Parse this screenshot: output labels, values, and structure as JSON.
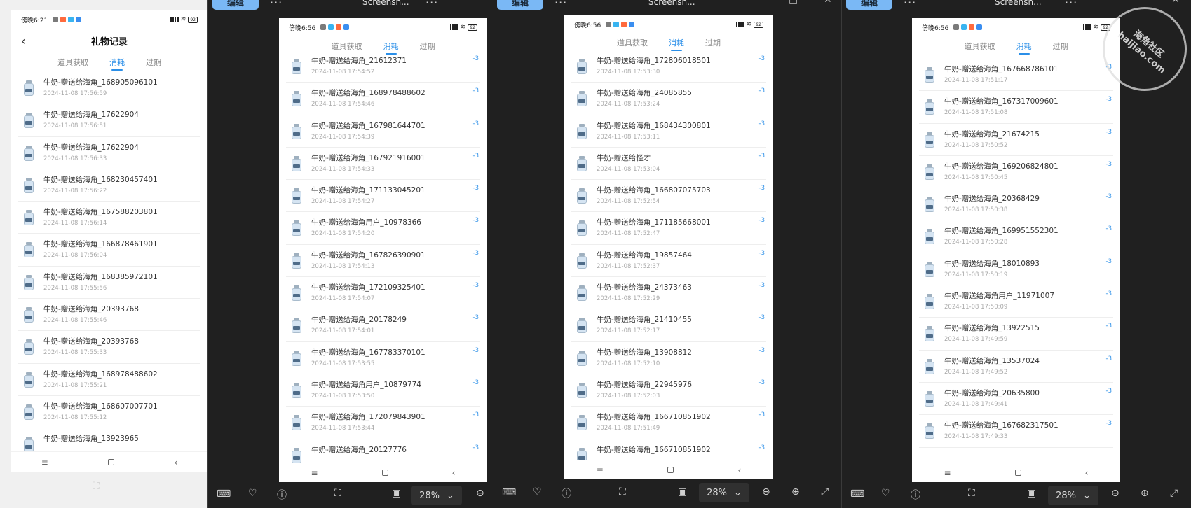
{
  "common": {
    "status_time_a": "傍晚6:21",
    "status_time_b": "傍晚6:56",
    "battery": "92",
    "tab_labels": [
      "道具获取",
      "消耗",
      "过期"
    ],
    "amount": "-3",
    "zoom": "28%",
    "edit_label": "编辑",
    "window_title": "Screensh..."
  },
  "panel1": {
    "page_title": "礼物记录",
    "rows": [
      {
        "name": "牛奶-赠送给海角_168905096101",
        "time": "2024-11-08 17:56:59"
      },
      {
        "name": "牛奶-赠送给海角_17622904",
        "time": "2024-11-08 17:56:51"
      },
      {
        "name": "牛奶-赠送给海角_17622904",
        "time": "2024-11-08 17:56:33"
      },
      {
        "name": "牛奶-赠送给海角_168230457401",
        "time": "2024-11-08 17:56:22"
      },
      {
        "name": "牛奶-赠送给海角_167588203801",
        "time": "2024-11-08 17:56:14"
      },
      {
        "name": "牛奶-赠送给海角_166878461901",
        "time": "2024-11-08 17:56:04"
      },
      {
        "name": "牛奶-赠送给海角_168385972101",
        "time": "2024-11-08 17:55:56"
      },
      {
        "name": "牛奶-赠送给海角_20393768",
        "time": "2024-11-08 17:55:46"
      },
      {
        "name": "牛奶-赠送给海角_20393768",
        "time": "2024-11-08 17:55:33"
      },
      {
        "name": "牛奶-赠送给海角_168978488602",
        "time": "2024-11-08 17:55:21"
      },
      {
        "name": "牛奶-赠送给海角_168607007701",
        "time": "2024-11-08 17:55:12"
      },
      {
        "name": "牛奶-赠送给海角_13923965",
        "time": ""
      }
    ]
  },
  "panel2": {
    "rows": [
      {
        "name": "牛奶-赠送给海角_21612371",
        "time": "2024-11-08 17:54:52"
      },
      {
        "name": "牛奶-赠送给海角_168978488602",
        "time": "2024-11-08 17:54:46"
      },
      {
        "name": "牛奶-赠送给海角_167981644701",
        "time": "2024-11-08 17:54:39"
      },
      {
        "name": "牛奶-赠送给海角_167921916001",
        "time": "2024-11-08 17:54:33"
      },
      {
        "name": "牛奶-赠送给海角_171133045201",
        "time": "2024-11-08 17:54:27"
      },
      {
        "name": "牛奶-赠送给海角用户_10978366",
        "time": "2024-11-08 17:54:20"
      },
      {
        "name": "牛奶-赠送给海角_167826390901",
        "time": "2024-11-08 17:54:13"
      },
      {
        "name": "牛奶-赠送给海角_172109325401",
        "time": "2024-11-08 17:54:07"
      },
      {
        "name": "牛奶-赠送给海角_20178249",
        "time": "2024-11-08 17:54:01"
      },
      {
        "name": "牛奶-赠送给海角_167783370101",
        "time": "2024-11-08 17:53:55"
      },
      {
        "name": "牛奶-赠送给海角用户_10879774",
        "time": "2024-11-08 17:53:50"
      },
      {
        "name": "牛奶-赠送给海角_172079843901",
        "time": "2024-11-08 17:53:44"
      },
      {
        "name": "牛奶-赠送给海角_20127776",
        "time": ""
      }
    ]
  },
  "panel3": {
    "rows": [
      {
        "name": "牛奶-赠送给海角_172806018501",
        "time": "2024-11-08 17:53:30"
      },
      {
        "name": "牛奶-赠送给海角_24085855",
        "time": "2024-11-08 17:53:24"
      },
      {
        "name": "牛奶-赠送给海角_168434300801",
        "time": "2024-11-08 17:53:11"
      },
      {
        "name": "牛奶-赠送给怪才",
        "time": "2024-11-08 17:53:04"
      },
      {
        "name": "牛奶-赠送给海角_166807075703",
        "time": "2024-11-08 17:52:54"
      },
      {
        "name": "牛奶-赠送给海角_171185668001",
        "time": "2024-11-08 17:52:47"
      },
      {
        "name": "牛奶-赠送给海角_19857464",
        "time": "2024-11-08 17:52:37"
      },
      {
        "name": "牛奶-赠送给海角_24373463",
        "time": "2024-11-08 17:52:29"
      },
      {
        "name": "牛奶-赠送给海角_21410455",
        "time": "2024-11-08 17:52:17"
      },
      {
        "name": "牛奶-赠送给海角_13908812",
        "time": "2024-11-08 17:52:10"
      },
      {
        "name": "牛奶-赠送给海角_22945976",
        "time": "2024-11-08 17:52:03"
      },
      {
        "name": "牛奶-赠送给海角_166710851902",
        "time": "2024-11-08 17:51:49"
      },
      {
        "name": "牛奶-赠送给海角_166710851902",
        "time": ""
      }
    ]
  },
  "panel4": {
    "rows": [
      {
        "name": "牛奶-赠送给海角_167668786101",
        "time": "2024-11-08 17:51:17"
      },
      {
        "name": "牛奶-赠送给海角_167317009601",
        "time": "2024-11-08 17:51:08"
      },
      {
        "name": "牛奶-赠送给海角_21674215",
        "time": "2024-11-08 17:50:52"
      },
      {
        "name": "牛奶-赠送给海角_169206824801",
        "time": "2024-11-08 17:50:45"
      },
      {
        "name": "牛奶-赠送给海角_20368429",
        "time": "2024-11-08 17:50:38"
      },
      {
        "name": "牛奶-赠送给海角_169951552301",
        "time": "2024-11-08 17:50:28"
      },
      {
        "name": "牛奶-赠送给海角_18010893",
        "time": "2024-11-08 17:50:19"
      },
      {
        "name": "牛奶-赠送给海角用户_11971007",
        "time": "2024-11-08 17:50:09"
      },
      {
        "name": "牛奶-赠送给海角_13922515",
        "time": "2024-11-08 17:49:59"
      },
      {
        "name": "牛奶-赠送给海角_13537024",
        "time": "2024-11-08 17:49:52"
      },
      {
        "name": "牛奶-赠送给海角_20635800",
        "time": "2024-11-08 17:49:41"
      },
      {
        "name": "牛奶-赠送给海角_167682317501",
        "time": "2024-11-08 17:49:33"
      }
    ]
  },
  "watermark": {
    "line1": "海角社区",
    "line2": "haijiao.com"
  },
  "colors": {
    "accent": "#2b8fe8",
    "desktop": "#202020",
    "edit_button": "#7ab8f5"
  }
}
